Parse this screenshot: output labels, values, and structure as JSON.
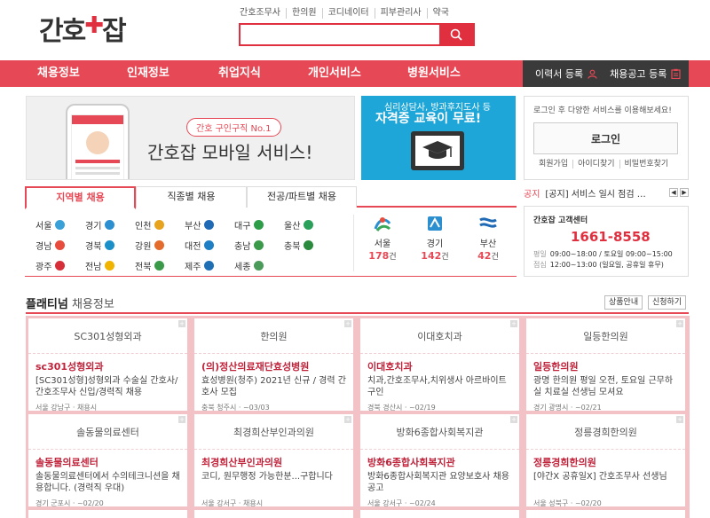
{
  "header": {
    "logo_left": "간호",
    "logo_cross": "✚",
    "logo_right": "잡",
    "top_links": [
      "간호조무사",
      "한의원",
      "코디네이터",
      "피부관리사",
      "약국"
    ],
    "search_placeholder": ""
  },
  "main_nav": {
    "items": [
      "채용정보",
      "인재정보",
      "취업지식",
      "개인서비스",
      "병원서비스"
    ],
    "resume_register": "이력서 등록",
    "job_register": "채용공고 등록"
  },
  "banners": {
    "mobile_tag": "간호 구인구직 No.1",
    "mobile_title": "간호잡 모바일 서비스!",
    "edu_sub": "심리상담사, 방과후지도사 등",
    "edu_title": "자격증 교육이 무료!"
  },
  "login": {
    "message": "로그인 후 다양한 서비스를 이용해보세요!",
    "button": "로그인",
    "links": [
      "회원가입",
      "아이디찾기",
      "비밀번호찾기"
    ]
  },
  "region_tabs": {
    "tabs": [
      "지역별 채용",
      "직종별 채용",
      "전공/파트별 채용"
    ],
    "regions": [
      {
        "name": "서울",
        "color": "#3aa1d8"
      },
      {
        "name": "경기",
        "color": "#2c8fd0"
      },
      {
        "name": "인천",
        "color": "#e8a31e"
      },
      {
        "name": "부산",
        "color": "#1f6ab5"
      },
      {
        "name": "대구",
        "color": "#2d9d48"
      },
      {
        "name": "울산",
        "color": "#2aa05a"
      },
      {
        "name": "경남",
        "color": "#e74c3c"
      },
      {
        "name": "경북",
        "color": "#1a8fc8"
      },
      {
        "name": "강원",
        "color": "#e36b2c"
      },
      {
        "name": "대전",
        "color": "#1e7fc4"
      },
      {
        "name": "충남",
        "color": "#3b9a4a"
      },
      {
        "name": "충북",
        "color": "#2a8a3e"
      },
      {
        "name": "광주",
        "color": "#d62f3a"
      },
      {
        "name": "전남",
        "color": "#f0b400"
      },
      {
        "name": "전북",
        "color": "#3a9a4a"
      },
      {
        "name": "제주",
        "color": "#1f6fb5"
      },
      {
        "name": "세종",
        "color": "#4a9a5a"
      }
    ],
    "highlights": [
      {
        "name": "서울",
        "count": "178",
        "unit": "건"
      },
      {
        "name": "경기",
        "count": "142",
        "unit": "건"
      },
      {
        "name": "부산",
        "count": "42",
        "unit": "건"
      }
    ]
  },
  "notice": {
    "label": "공지",
    "text": "[공지] 서비스 일시 점검 …"
  },
  "customer_center": {
    "title": "간호잡 고객센터",
    "phone": "1661-8558",
    "weekday_label": "평일",
    "weekday_hours": "09:00~18:00 / 토요일 09:00~15:00",
    "lunch_label": "점심",
    "lunch_hours": "12:00~13:00 (일요일, 공휴일 휴무)"
  },
  "platinum": {
    "title_bold": "플래티넘",
    "title_rest": " 채용정보",
    "btn_product": "상품안내",
    "btn_apply": "신청하기",
    "cards": [
      {
        "company": "SC301성형외과",
        "name": "sc301성형외과",
        "desc": "[SC301성형]성형외과 수술실 간호사/간호조무사 신입/경력직 채용",
        "meta": "서울 강남구 · 채용시"
      },
      {
        "company": "한의원",
        "name": "(의)정산의료재단효성병원",
        "desc": "효성병원(청주) 2021년 신규 / 경력 간호사 모집",
        "meta": "충북 청주시 · ~03/03"
      },
      {
        "company": "이대호치과",
        "name": "이대호치과",
        "desc": "치과,간호조무사,치위생사 아르바이트 구인",
        "meta": "경북 경산시 · ~02/19"
      },
      {
        "company": "일등한의원",
        "name": "일등한의원",
        "desc": "광명 한의원 평일 오전, 토요일 근무하실 치료실 선생님 모셔요",
        "meta": "경기 광명시 · ~02/21"
      },
      {
        "company": "솔동물의료센터",
        "name": "솔동물의료센터",
        "desc": "솔동물의료센터에서 수의테크니션을 채용합니다. (경력직 우대)",
        "meta": "경기 군포시 · ~02/20"
      },
      {
        "company": "최경희산부인과의원",
        "name": "최경희산부인과의원",
        "desc": "코디, 원무행정 가능한분...구합니다",
        "meta": "서울 강서구 · 채용시"
      },
      {
        "company": "방화6종합사회복지관",
        "name": "방화6종합사회복지관",
        "desc": "방화6종합사회복지관 요양보호사 채용공고",
        "meta": "서울 강서구 · ~02/24"
      },
      {
        "company": "정릉경희한의원",
        "name": "정릉경희한의원",
        "desc": "[야간X 공휴일X] 간호조무사 선생님",
        "meta": "서울 성북구 · ~02/20"
      }
    ]
  }
}
